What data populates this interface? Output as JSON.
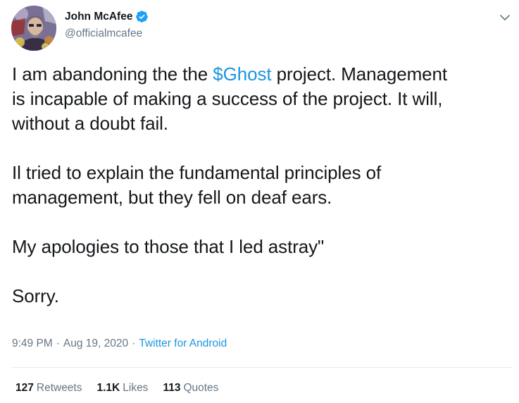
{
  "author": {
    "display_name": "John McAfee",
    "handle": "@officialmcafee",
    "verified": true
  },
  "icons": {
    "verified": "verified-badge-icon",
    "menu": "chevron-down-icon",
    "avatar": "profile-avatar"
  },
  "tweet": {
    "para1_prefix": "I am abandoning the the ",
    "cashtag": "$Ghost",
    "para1_suffix_line1": " project. Management",
    "para1_line2": "is incapable of making a success of the project. It will,",
    "para1_line3": "without a doubt fail.",
    "para2_line1": "Il tried to explain the fundamental principles of",
    "para2_line2": "management, but they fell on deaf ears.",
    "para3": "My apologies to those that I led astray\"",
    "para4": "Sorry."
  },
  "meta": {
    "time": "9:49 PM",
    "separator": "·",
    "date": "Aug 19, 2020",
    "source": "Twitter for Android"
  },
  "stats": {
    "retweets_count": "127",
    "retweets_label": "Retweets",
    "likes_count": "1.1K",
    "likes_label": "Likes",
    "quotes_count": "113",
    "quotes_label": "Quotes"
  },
  "colors": {
    "text": "#14171a",
    "secondary": "#657786",
    "link": "#1b95e0",
    "divider": "#e6ecf0",
    "verified": "#1da1f2"
  }
}
